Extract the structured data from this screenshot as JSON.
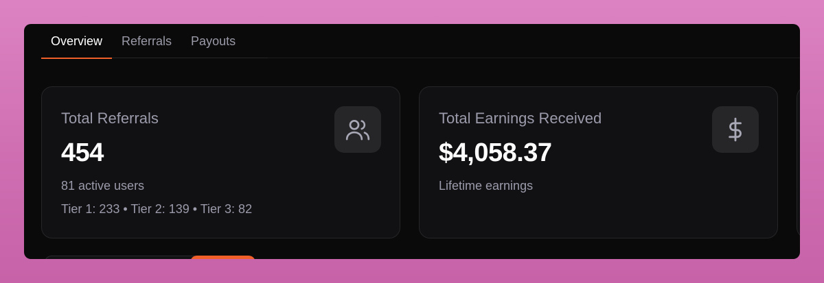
{
  "tabs": [
    {
      "label": "Overview",
      "active": true
    },
    {
      "label": "Referrals",
      "active": false
    },
    {
      "label": "Payouts",
      "active": false
    }
  ],
  "cards": [
    {
      "title": "Total Referrals",
      "value": "454",
      "subtitle": "81 active users",
      "details": "Tier 1: 233 • Tier 2: 139 • Tier 3: 82",
      "icon": "users-icon"
    },
    {
      "title": "Total Earnings Received",
      "value": "$4,058.37",
      "subtitle": "Lifetime earnings",
      "icon": "dollar-icon"
    }
  ],
  "colors": {
    "accent": "#f2602a",
    "background": "#0a0a0a",
    "card": "#111113",
    "muted_text": "#9b9bab",
    "desktop": "#d478bb"
  }
}
